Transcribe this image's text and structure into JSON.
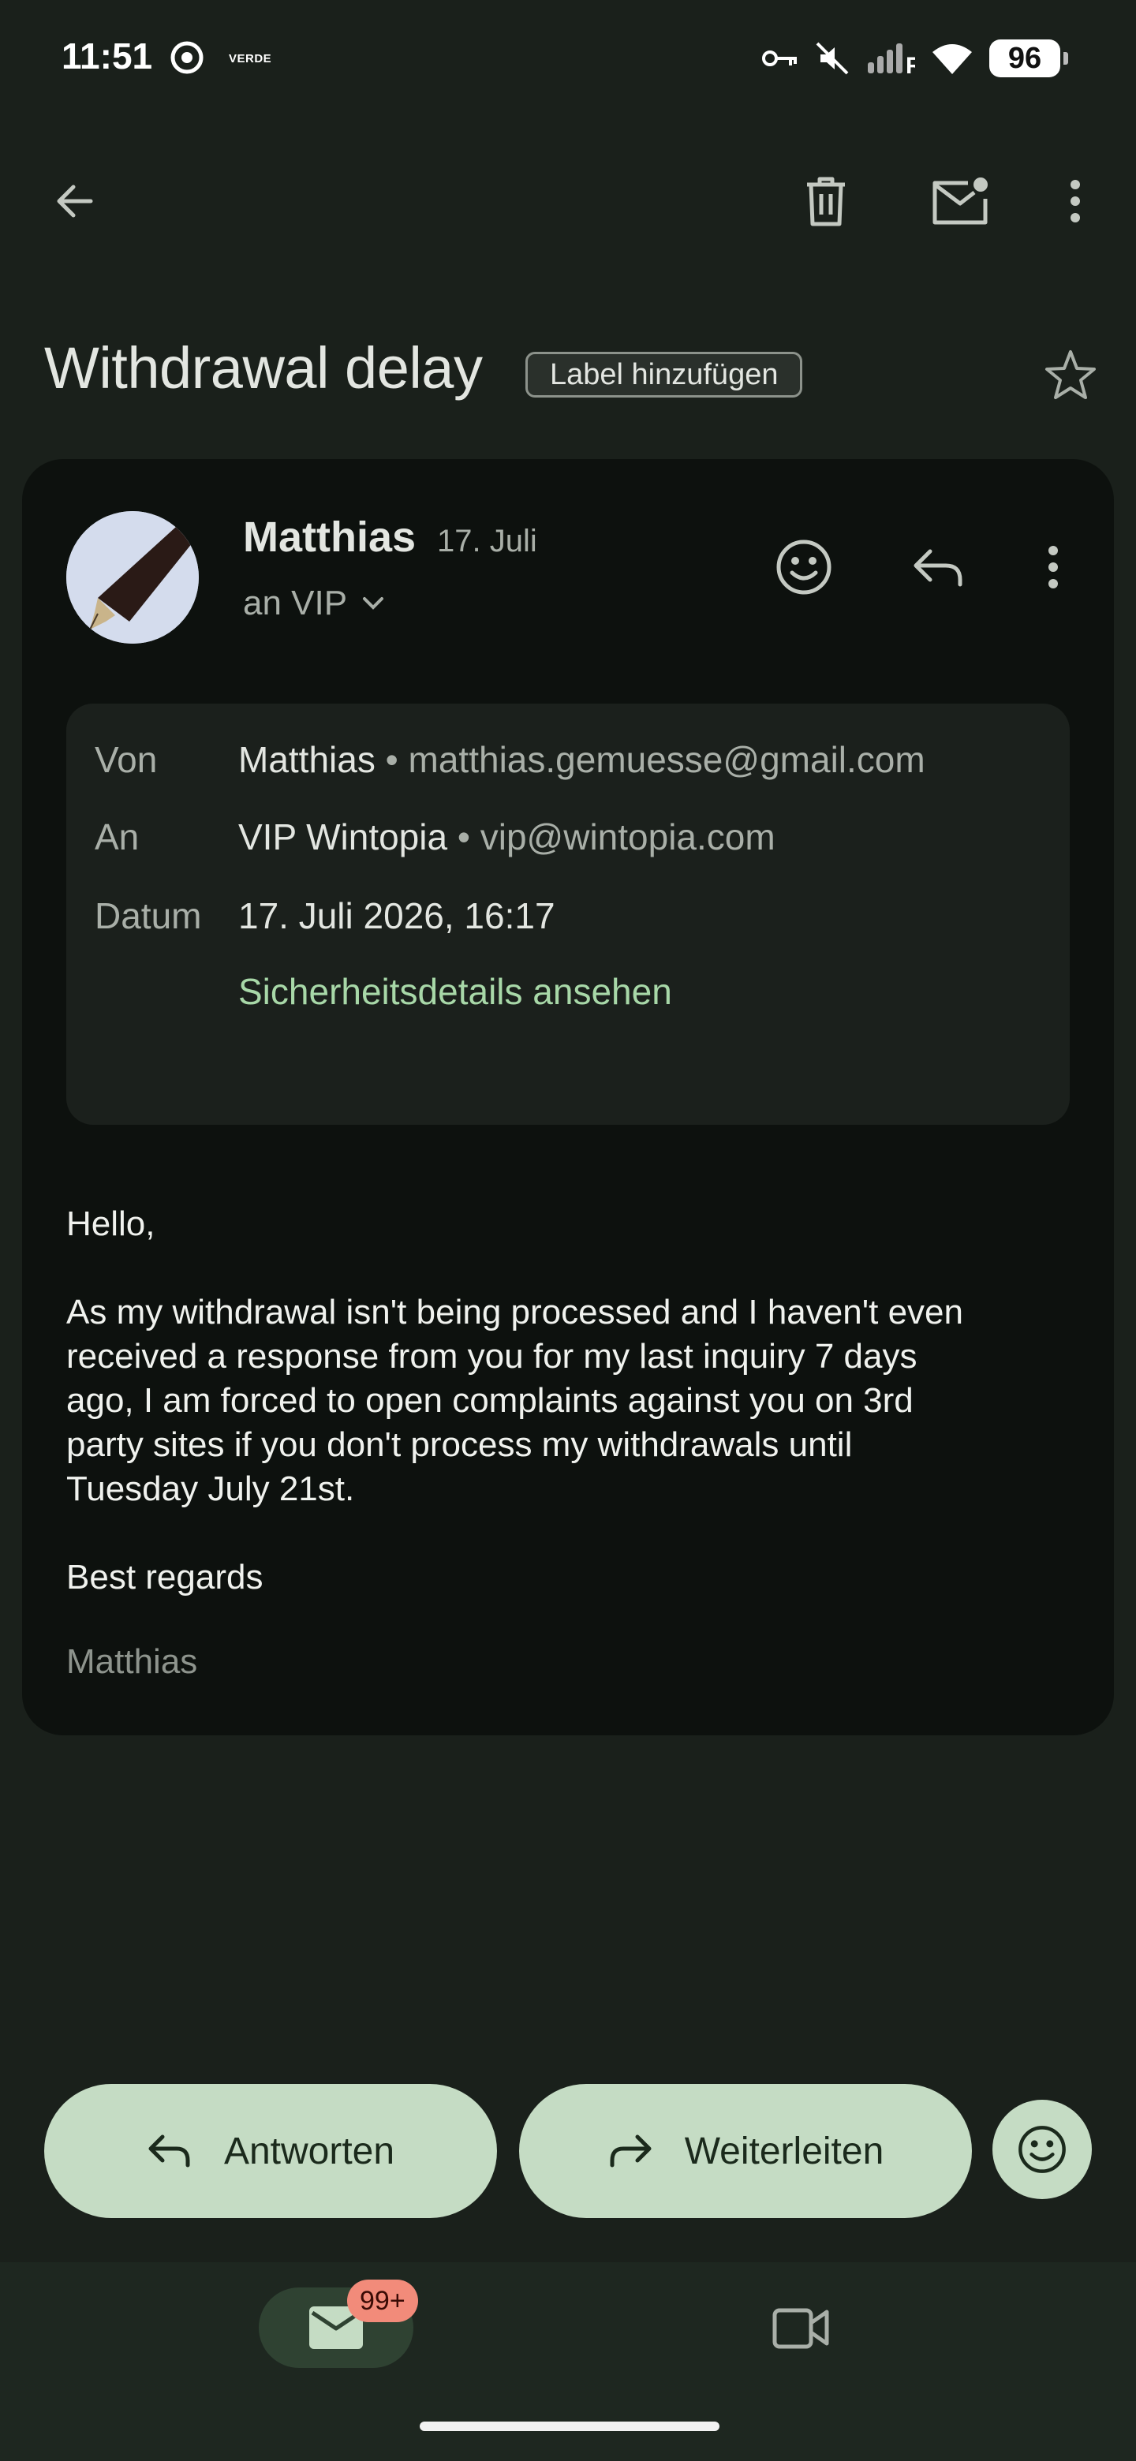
{
  "status_bar": {
    "time": "11:51",
    "carrier_label": "VERDE",
    "battery": "96"
  },
  "email": {
    "subject": "Withdrawal delay",
    "add_label": "Label hinzufügen",
    "sender_name": "Matthias",
    "date_short": "17. Juli",
    "recipient": "an VIP",
    "details": {
      "from_label": "Von",
      "from_name": "Matthias",
      "from_email": "matthias.gemuesse@gmail.com",
      "to_label": "An",
      "to_name": "VIP Wintopia",
      "to_email": "vip@wintopia.com",
      "date_label": "Datum",
      "date_value": "17. Juli 2026, 16:17",
      "security_link": "Sicherheitsdetails ansehen"
    },
    "body": {
      "greeting": "Hello,",
      "paragraph_lines": [
        "As my withdrawal isn't being processed and I haven't even",
        "received a response from you for my last inquiry 7 days",
        "ago, I am forced to open complaints against you on 3rd",
        "party sites if you don't process my withdrawals until",
        "Tuesday July 21st."
      ],
      "closing": "Best regards",
      "signature": "Matthias"
    }
  },
  "actions": {
    "reply": "Antworten",
    "forward": "Weiterleiten"
  },
  "bottom_nav": {
    "mail_badge": "99+"
  },
  "icons": {
    "back": "arrow-left-icon",
    "delete": "trash-icon",
    "mark_unread": "mail-unread-icon",
    "more": "more-vert-icon",
    "star": "star-outline-icon",
    "emoji": "emoji-icon",
    "reply": "reply-icon",
    "forward": "forward-icon",
    "mail": "mail-icon",
    "video": "video-icon"
  },
  "colors": {
    "background": "#1a201b",
    "card": "#0d110e",
    "accent_button": "#c5dcc4",
    "link": "#a8d8a8",
    "badge": "#f28b7a"
  }
}
